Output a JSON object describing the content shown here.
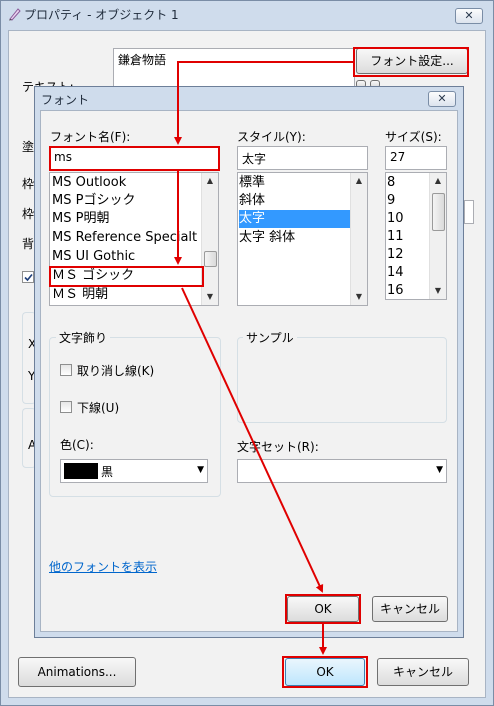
{
  "outer": {
    "title": "プロパティ - オブジェクト 1",
    "close_label": "✕",
    "text_preview": "鎌倉物語",
    "font_settings_button": "フォント設定...",
    "text_label": "テキスト:",
    "side_label_1": "塗",
    "side_label_2": "枠",
    "side_label_3": "枠",
    "side_label_4": "背",
    "side_label_x": "X",
    "side_label_y": "Y",
    "side_label_a": "A",
    "animations_button": "Animations...",
    "ok_button": "OK",
    "cancel_button": "キャンセル"
  },
  "font_dialog": {
    "title": "フォント",
    "close_label": "✕",
    "font_name_label": "フォント名(F):",
    "font_name_value": "ms",
    "fonts": [
      "MS Outlook",
      "MS Pゴシック",
      "MS P明朝",
      "MS Reference Specialt",
      "MS UI Gothic",
      "ＭＳ ゴシック",
      "ＭＳ 明朝"
    ],
    "style_label": "スタイル(Y):",
    "style_value": "太字",
    "styles": [
      "標準",
      "斜体",
      "太字",
      "太字 斜体"
    ],
    "selected_style": "太字",
    "size_label": "サイズ(S):",
    "size_value": "27",
    "sizes": [
      "8",
      "9",
      "10",
      "11",
      "12",
      "14",
      "16"
    ],
    "effects_label": "文字飾り",
    "strikeout_label": "取り消し線(K)",
    "underline_label": "下線(U)",
    "color_label": "色(C):",
    "color_value": "黒",
    "color_swatch": "#000000",
    "sample_label": "サンプル",
    "charset_label": "文字セット(R):",
    "charset_value": "",
    "more_fonts_link": "他のフォントを表示",
    "ok_button": "OK",
    "cancel_button": "キャンセル"
  },
  "annotation_color": "#e00000",
  "selection_color": "#3399ff",
  "link_color": "#0066cc"
}
